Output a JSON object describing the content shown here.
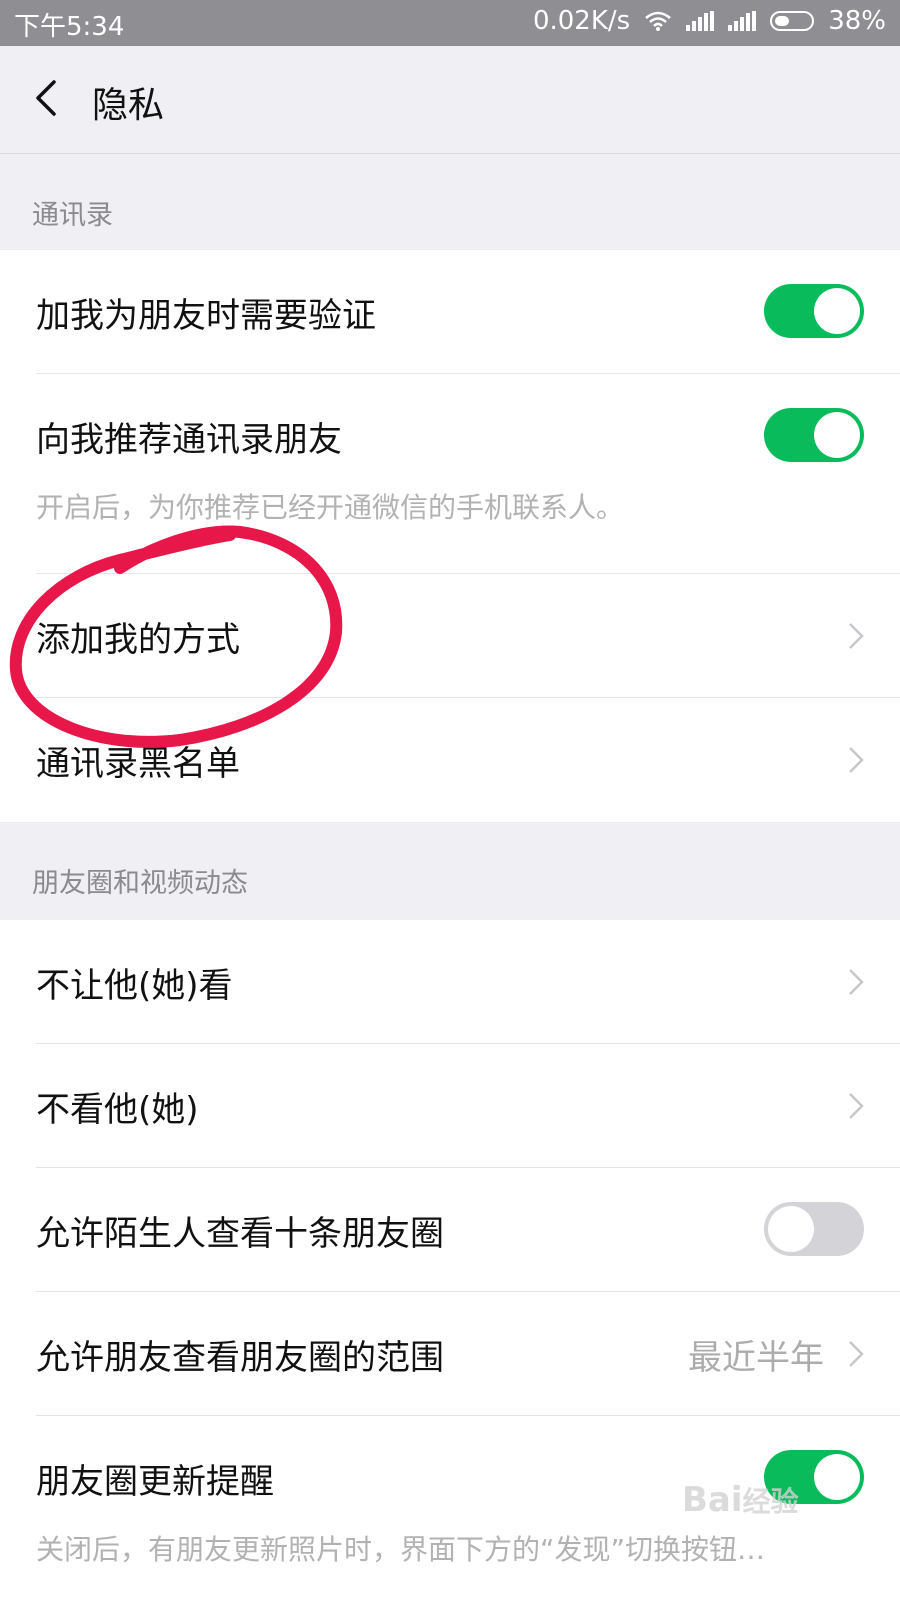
{
  "status_bar": {
    "time": "下午5:34",
    "speed": "0.02K/s",
    "battery": "38%"
  },
  "nav": {
    "title": "隐私"
  },
  "sections": {
    "contacts": {
      "header": "通讯录",
      "rows": [
        {
          "label": "加我为朋友时需要验证",
          "toggle": "on"
        },
        {
          "label": "向我推荐通讯录朋友",
          "toggle": "on",
          "desc": "开启后，为你推荐已经开通微信的手机联系人。"
        },
        {
          "label": "添加我的方式"
        },
        {
          "label": "通讯录黑名单"
        }
      ]
    },
    "moments": {
      "header": "朋友圈和视频动态",
      "rows": [
        {
          "label": "不让他(她)看"
        },
        {
          "label": "不看他(她)"
        },
        {
          "label": "允许陌生人查看十条朋友圈",
          "toggle": "off"
        },
        {
          "label": "允许朋友查看朋友圈的范围",
          "value": "最近半年"
        },
        {
          "label": "朋友圈更新提醒",
          "toggle": "on",
          "desc": "关闭后，有朋友更新照片时，界面下方的“发现”切换按钮…"
        }
      ]
    }
  },
  "watermark": "Bai经验",
  "colors": {
    "toggle_on": "#09BB5A",
    "toggle_off": "#D4D4D8",
    "annotation": "#E8174A"
  }
}
